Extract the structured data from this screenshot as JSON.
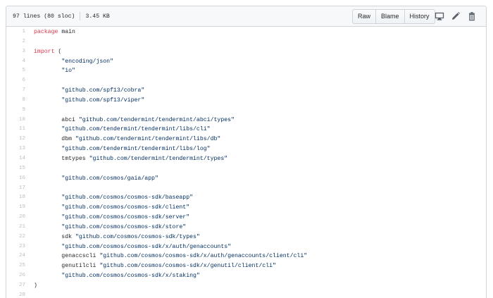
{
  "file_info": {
    "lines": "97 lines (80 sloc)",
    "size": "3.45 KB"
  },
  "actions": {
    "raw": "Raw",
    "blame": "Blame",
    "history": "History"
  },
  "icons": {
    "desktop": "desktop-icon",
    "edit": "pencil-icon",
    "delete": "trash-icon"
  },
  "colors": {
    "keyword": "#d73a49",
    "string": "#032f62",
    "text": "#24292e",
    "line_number": "rgba(27,31,35,0.3)"
  },
  "code_lines": [
    {
      "n": "1",
      "parts": [
        {
          "t": "package",
          "c": "kw"
        },
        {
          "t": " main",
          "c": ""
        }
      ]
    },
    {
      "n": "2",
      "parts": []
    },
    {
      "n": "3",
      "parts": [
        {
          "t": "import",
          "c": "kw"
        },
        {
          "t": " (",
          "c": ""
        }
      ]
    },
    {
      "n": "4",
      "parts": [
        {
          "t": "        ",
          "c": ""
        },
        {
          "t": "\"encoding/json\"",
          "c": "str"
        }
      ]
    },
    {
      "n": "5",
      "parts": [
        {
          "t": "        ",
          "c": ""
        },
        {
          "t": "\"io\"",
          "c": "str"
        }
      ]
    },
    {
      "n": "6",
      "parts": []
    },
    {
      "n": "7",
      "parts": [
        {
          "t": "        ",
          "c": ""
        },
        {
          "t": "\"github.com/spf13/cobra\"",
          "c": "str"
        }
      ]
    },
    {
      "n": "8",
      "parts": [
        {
          "t": "        ",
          "c": ""
        },
        {
          "t": "\"github.com/spf13/viper\"",
          "c": "str"
        }
      ]
    },
    {
      "n": "9",
      "parts": []
    },
    {
      "n": "10",
      "parts": [
        {
          "t": "        abci ",
          "c": ""
        },
        {
          "t": "\"github.com/tendermint/tendermint/abci/types\"",
          "c": "str"
        }
      ]
    },
    {
      "n": "11",
      "parts": [
        {
          "t": "        ",
          "c": ""
        },
        {
          "t": "\"github.com/tendermint/tendermint/libs/cli\"",
          "c": "str"
        }
      ]
    },
    {
      "n": "12",
      "parts": [
        {
          "t": "        dbm ",
          "c": ""
        },
        {
          "t": "\"github.com/tendermint/tendermint/libs/db\"",
          "c": "str"
        }
      ]
    },
    {
      "n": "13",
      "parts": [
        {
          "t": "        ",
          "c": ""
        },
        {
          "t": "\"github.com/tendermint/tendermint/libs/log\"",
          "c": "str"
        }
      ]
    },
    {
      "n": "14",
      "parts": [
        {
          "t": "        tmtypes ",
          "c": ""
        },
        {
          "t": "\"github.com/tendermint/tendermint/types\"",
          "c": "str"
        }
      ]
    },
    {
      "n": "15",
      "parts": []
    },
    {
      "n": "16",
      "parts": [
        {
          "t": "        ",
          "c": ""
        },
        {
          "t": "\"github.com/cosmos/gaia/app\"",
          "c": "str"
        }
      ]
    },
    {
      "n": "17",
      "parts": []
    },
    {
      "n": "18",
      "parts": [
        {
          "t": "        ",
          "c": ""
        },
        {
          "t": "\"github.com/cosmos/cosmos-sdk/baseapp\"",
          "c": "str"
        }
      ]
    },
    {
      "n": "19",
      "parts": [
        {
          "t": "        ",
          "c": ""
        },
        {
          "t": "\"github.com/cosmos/cosmos-sdk/client\"",
          "c": "str"
        }
      ]
    },
    {
      "n": "20",
      "parts": [
        {
          "t": "        ",
          "c": ""
        },
        {
          "t": "\"github.com/cosmos/cosmos-sdk/server\"",
          "c": "str"
        }
      ]
    },
    {
      "n": "21",
      "parts": [
        {
          "t": "        ",
          "c": ""
        },
        {
          "t": "\"github.com/cosmos/cosmos-sdk/store\"",
          "c": "str"
        }
      ]
    },
    {
      "n": "22",
      "parts": [
        {
          "t": "        sdk ",
          "c": ""
        },
        {
          "t": "\"github.com/cosmos/cosmos-sdk/types\"",
          "c": "str"
        }
      ]
    },
    {
      "n": "23",
      "parts": [
        {
          "t": "        ",
          "c": ""
        },
        {
          "t": "\"github.com/cosmos/cosmos-sdk/x/auth/genaccounts\"",
          "c": "str"
        }
      ]
    },
    {
      "n": "24",
      "parts": [
        {
          "t": "        genaccscli ",
          "c": ""
        },
        {
          "t": "\"github.com/cosmos/cosmos-sdk/x/auth/genaccounts/client/cli\"",
          "c": "str"
        }
      ]
    },
    {
      "n": "25",
      "parts": [
        {
          "t": "        genutilcli ",
          "c": ""
        },
        {
          "t": "\"github.com/cosmos/cosmos-sdk/x/genutil/client/cli\"",
          "c": "str"
        }
      ]
    },
    {
      "n": "26",
      "parts": [
        {
          "t": "        ",
          "c": ""
        },
        {
          "t": "\"github.com/cosmos/cosmos-sdk/x/staking\"",
          "c": "str"
        }
      ]
    },
    {
      "n": "27",
      "parts": [
        {
          "t": ")",
          "c": ""
        }
      ]
    },
    {
      "n": "28",
      "parts": []
    }
  ]
}
